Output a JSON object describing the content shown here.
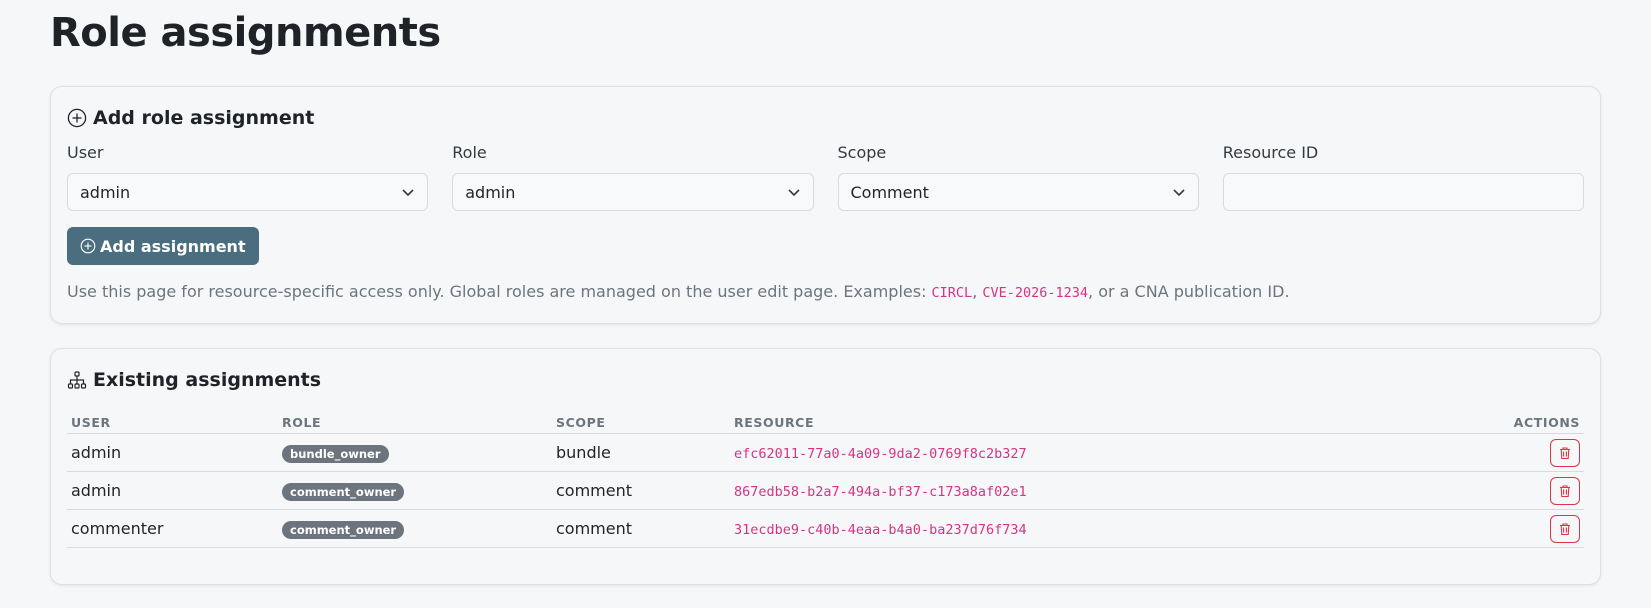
{
  "page": {
    "title": "Role assignments"
  },
  "add_card": {
    "title": "Add role assignment",
    "icon": "plus-circle-icon",
    "fields": {
      "user": {
        "label": "User",
        "value": "admin"
      },
      "role": {
        "label": "Role",
        "value": "admin"
      },
      "scope": {
        "label": "Scope",
        "value": "Comment"
      },
      "resource_id": {
        "label": "Resource ID",
        "value": "",
        "placeholder": ""
      }
    },
    "submit_label": "Add assignment",
    "help": {
      "prefix": "Use this page for resource-specific access only. Global roles are managed on the user edit page. Examples: ",
      "example1": "CIRCL",
      "sep": ", ",
      "example2": "CVE-2026-1234",
      "suffix": ", or a CNA publication ID."
    }
  },
  "existing_card": {
    "title": "Existing assignments",
    "icon": "hierarchy-icon",
    "columns": {
      "user": "USER",
      "role": "ROLE",
      "scope": "SCOPE",
      "resource": "RESOURCE",
      "actions": "ACTIONS"
    },
    "rows": [
      {
        "user": "admin",
        "role": "bundle_owner",
        "scope": "bundle",
        "resource": "efc62011-77a0-4a09-9da2-0769f8c2b327"
      },
      {
        "user": "admin",
        "role": "comment_owner",
        "scope": "comment",
        "resource": "867edb58-b2a7-494a-bf37-c173a8af02e1"
      },
      {
        "user": "commenter",
        "role": "comment_owner",
        "scope": "comment",
        "resource": "31ecdbe9-c40b-4eaa-b4a0-ba237d76f734"
      }
    ]
  },
  "colors": {
    "primary_button": "#4a6e80",
    "danger": "#dc3545",
    "code": "#d63384",
    "badge": "#6c757d"
  }
}
